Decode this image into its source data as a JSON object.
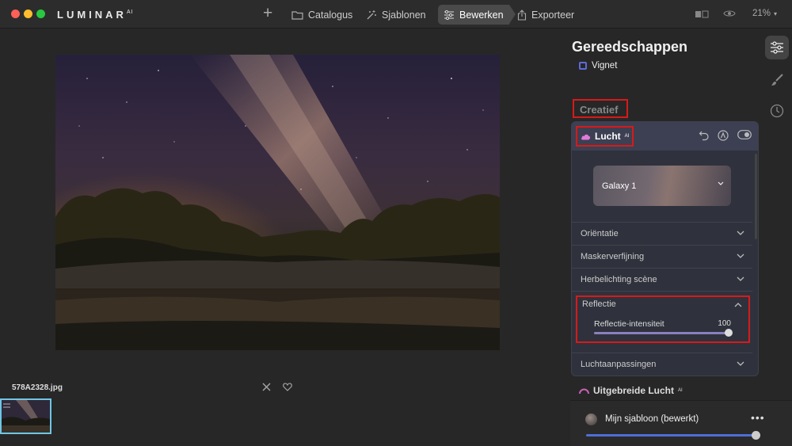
{
  "app": {
    "logo": "LUMINAR",
    "logo_ai": "AI"
  },
  "nav": {
    "catalogus": "Catalogus",
    "sjablonen": "Sjablonen",
    "bewerken": "Bewerken",
    "exporteer": "Exporteer"
  },
  "zoom": {
    "value": "21%"
  },
  "photo": {
    "filename": "578A2328.jpg"
  },
  "panel": {
    "title": "Gereedschappen",
    "vignet_label": "Vignet",
    "section_label": "Creatief",
    "lucht": {
      "label": "Lucht",
      "ai_badge": "AI",
      "preset": "Galaxy 1",
      "sections": [
        "Oriëntatie",
        "Maskerverfijning",
        "Herbelichting scène"
      ],
      "reflectie": {
        "title": "Reflectie",
        "slider_label": "Reflectie-intensiteit",
        "slider_value": "100",
        "fill_fraction": 1.0
      },
      "last_section": "Luchtaanpassingen"
    },
    "uitgebreid": {
      "label": "Uitgebreide Lucht",
      "ai_badge": "AI"
    }
  },
  "template": {
    "name": "Mijn sjabloon (bewerkt)",
    "more": "•••",
    "amount_fraction": 1.0
  },
  "colors": {
    "accent": "#4f6fd6",
    "highlight": "#d81a1a",
    "sky_icon": "#e07ad8"
  }
}
